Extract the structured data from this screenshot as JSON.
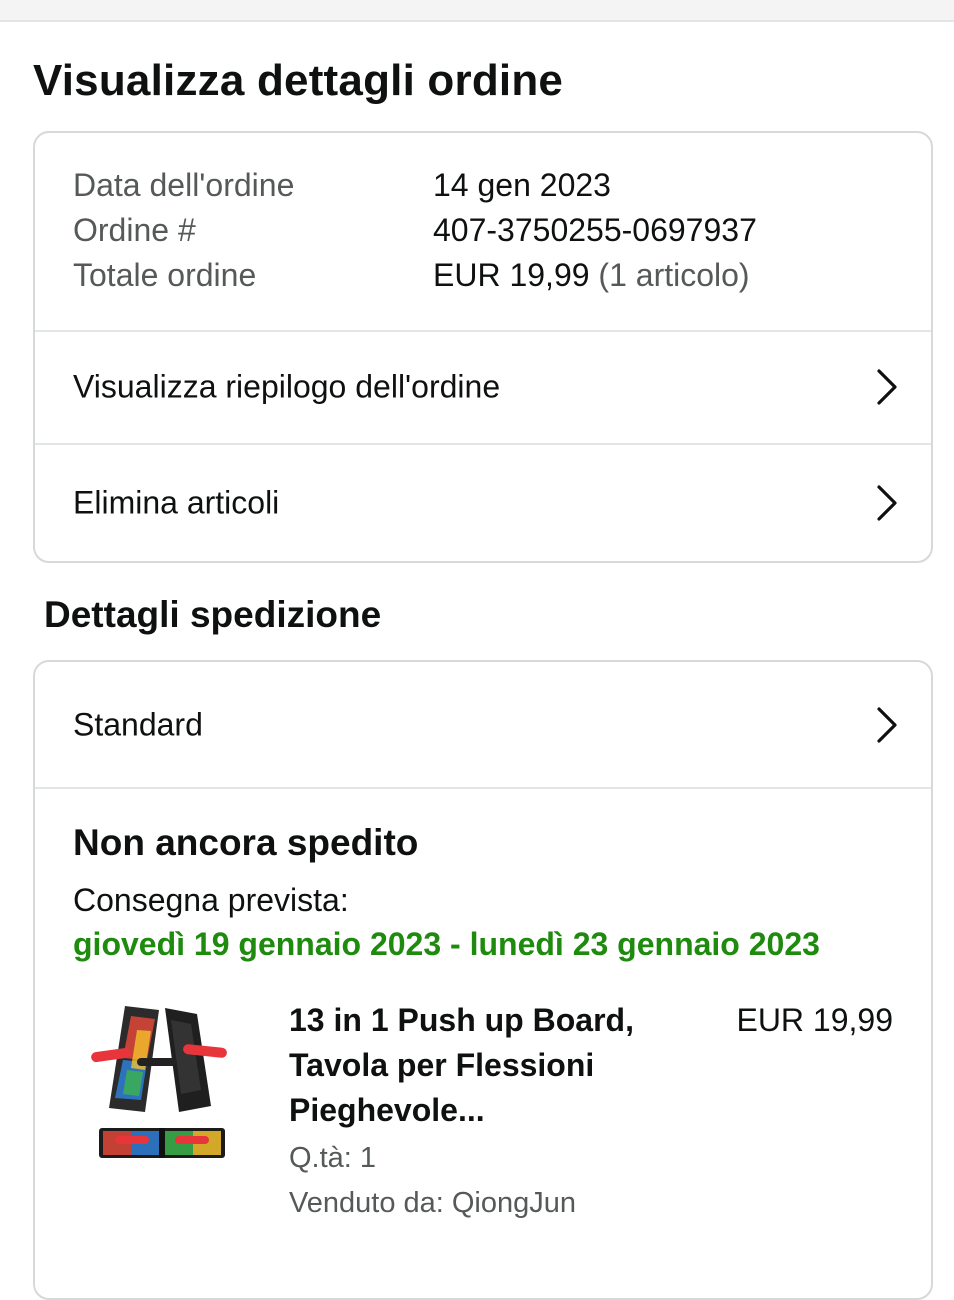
{
  "page_title": "Visualizza dettagli ordine",
  "order_info": {
    "date_label": "Data dell'ordine",
    "date_value": "14 gen 2023",
    "number_label": "Ordine #",
    "number_value": "407-3750255-0697937",
    "total_label": "Totale ordine",
    "total_value": "EUR 19,99",
    "total_items": "(1 articolo)"
  },
  "order_links": [
    {
      "label": "Visualizza riepilogo dell'ordine",
      "icon": "chevron-right-icon"
    },
    {
      "label": "Elimina articoli",
      "icon": "chevron-right-icon"
    }
  ],
  "shipping": {
    "section_title": "Dettagli spedizione",
    "method_label": "Standard",
    "status": "Non ancora spedito",
    "delivery_label": "Consegna prevista:",
    "delivery_dates": "giovedì 19 gennaio 2023 - lunedì 23 gennaio 2023",
    "delivery_color": "#1e8a0e"
  },
  "product": {
    "title": "13 in 1 Push up Board, Tavola per Flessioni Pieghevole...",
    "price": "EUR 19,99",
    "quantity": "Q.tà: 1",
    "seller": "Venduto da: QiongJun",
    "image_icon": "push-up-board-image"
  }
}
